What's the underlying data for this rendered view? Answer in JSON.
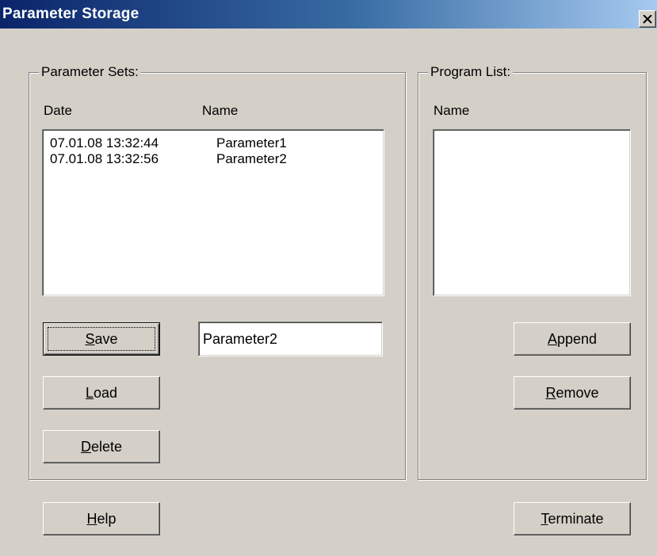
{
  "window": {
    "title": "Parameter Storage"
  },
  "parameter_sets": {
    "group_label": "Parameter Sets:",
    "columns": {
      "date": "Date",
      "name": "Name"
    },
    "rows": [
      {
        "date": "07.01.08 13:32:44",
        "name": "Parameter1"
      },
      {
        "date": "07.01.08 13:32:56",
        "name": "Parameter2"
      }
    ],
    "name_input_value": "Parameter2",
    "buttons": {
      "save": {
        "mnemonic": "S",
        "rest": "ave"
      },
      "load": {
        "mnemonic": "L",
        "rest": "oad"
      },
      "delete": {
        "mnemonic": "D",
        "rest": "elete"
      }
    }
  },
  "program_list": {
    "group_label": "Program List:",
    "columns": {
      "name": "Name"
    },
    "rows": [],
    "buttons": {
      "append": {
        "mnemonic": "A",
        "rest": "ppend"
      },
      "remove": {
        "mnemonic": "R",
        "rest": "emove"
      }
    }
  },
  "footer": {
    "help": {
      "mnemonic": "H",
      "rest": "elp"
    },
    "terminate": {
      "mnemonic": "T",
      "rest": "erminate"
    }
  },
  "icons": {
    "close": "close-icon"
  }
}
